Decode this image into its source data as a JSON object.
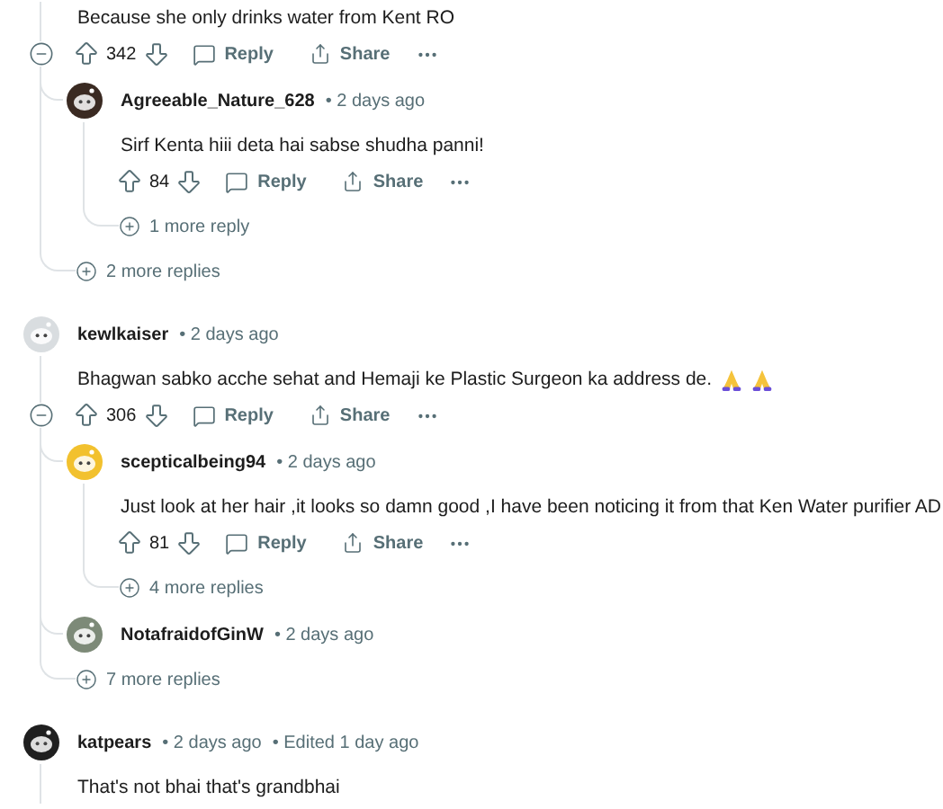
{
  "comments": [
    {
      "kind": "partial",
      "body": "Because she only drinks water from Kent RO",
      "collapsible": true,
      "votes": "342",
      "actions": [
        "Reply",
        "Share"
      ],
      "replies": [
        {
          "kind": "full",
          "user": "Agreeable_Nature_628",
          "color": "#3a2a22",
          "time": "• 2 days ago",
          "body": "Sirf Kenta hiii deta hai sabse shudha panni!",
          "collapsible": false,
          "votes": "84",
          "actions": [
            "Reply",
            "Share"
          ],
          "more": "1 more reply"
        }
      ],
      "more": "2 more replies"
    },
    {
      "kind": "full",
      "user": "kewlkaiser",
      "color": "#d9dde0",
      "time": "• 2 days ago",
      "body": "Bhagwan sabko acche sehat and Hemaji ke Plastic Surgeon ka address de.",
      "reactions": [
        {
          "kind": "folded-hands"
        },
        {
          "kind": "folded-hands"
        }
      ],
      "collapsible": true,
      "votes": "306",
      "actions": [
        "Reply",
        "Share"
      ],
      "replies": [
        {
          "kind": "full",
          "user": "scepticalbeing94",
          "color": "#f2c12e",
          "time": "• 2 days ago",
          "body": "Just look at her hair ,it looks so damn good ,I have been noticing it from that Ken Water purifier AD",
          "collapsible": false,
          "votes": "81",
          "actions": [
            "Reply",
            "Share"
          ],
          "more": "4 more replies"
        },
        {
          "kind": "full",
          "user": "NotafraidofGinW",
          "color": "#7d8a78",
          "time": "• 2 days ago"
        }
      ],
      "more": "7 more replies"
    },
    {
      "kind": "full",
      "user": "katpears",
      "color": "#1f1f1f",
      "time": "• 2 days ago",
      "edited": "• Edited 1 day ago",
      "body": "That's not bhai that's grandbhai"
    }
  ]
}
